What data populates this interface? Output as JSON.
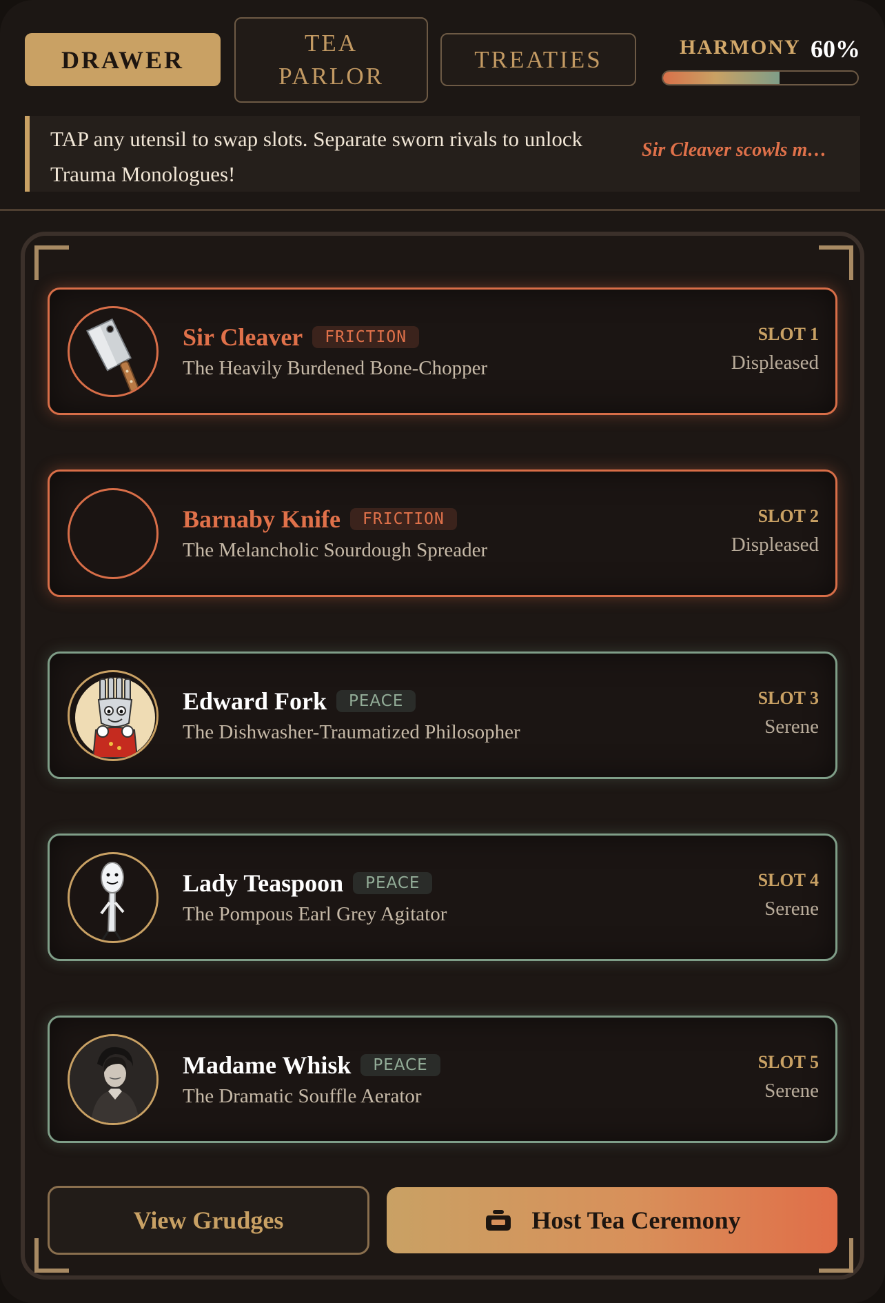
{
  "nav": {
    "tabs": [
      {
        "label": "DRAWER",
        "active": true
      },
      {
        "label": "TEA PARLOR",
        "line1": "TEA",
        "line2": "PARLOR",
        "active": false
      },
      {
        "label": "TREATIES",
        "active": false
      }
    ]
  },
  "harmony": {
    "label": "HARMONY",
    "value_text": "60%",
    "value": 0.6
  },
  "hint": {
    "text": "TAP any utensil to swap slots. Separate sworn rivals to unlock Trauma Monologues!",
    "ticker": "Sir Cleaver scowls m…"
  },
  "utensils": [
    {
      "name": "Sir Cleaver",
      "status": "FRICTION",
      "subtitle": "The Heavily Burdened Bone-Chopper",
      "slot": "SLOT 1",
      "mood": "Displeased",
      "avatar_icon": "cleaver-icon"
    },
    {
      "name": "Barnaby Knife",
      "status": "FRICTION",
      "subtitle": "The Melancholic Sourdough Spreader",
      "slot": "SLOT 2",
      "mood": "Displeased",
      "avatar_icon": "empty-avatar"
    },
    {
      "name": "Edward Fork",
      "status": "PEACE",
      "subtitle": "The Dishwasher-Traumatized Philosopher",
      "slot": "SLOT 3",
      "mood": "Serene",
      "avatar_icon": "cartoon-fork-icon"
    },
    {
      "name": "Lady Teaspoon",
      "status": "PEACE",
      "subtitle": "The Pompous Earl Grey Agitator",
      "slot": "SLOT 4",
      "mood": "Serene",
      "avatar_icon": "cartoon-spoon-icon"
    },
    {
      "name": "Madame Whisk",
      "status": "PEACE",
      "subtitle": "The Dramatic Souffle Aerator",
      "slot": "SLOT 5",
      "mood": "Serene",
      "avatar_icon": "portrait-icon"
    }
  ],
  "actions": {
    "grudges_label": "View Grudges",
    "tea_label": "Host Tea Ceremony",
    "tea_icon": "teapot-icon"
  },
  "colors": {
    "gold": "#c9a164",
    "friction": "#d86e48",
    "peace": "#7f9e88",
    "background": "#1c1714"
  }
}
